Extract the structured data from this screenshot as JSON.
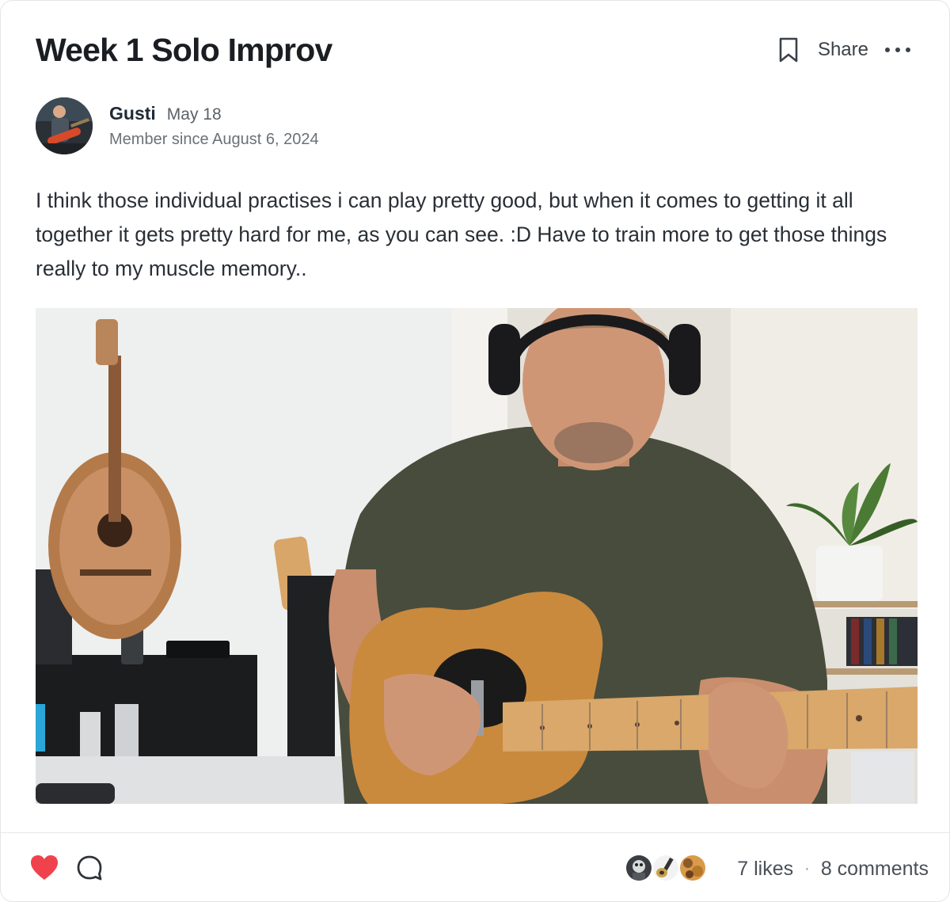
{
  "post": {
    "title": "Week 1 Solo Improv",
    "body": "I think those individual practises i can play pretty good, but when it comes to getting it all together it gets pretty hard for me, as you can see. :D Have to train more to get those things really to my muscle memory.."
  },
  "header": {
    "bookmark_icon": "bookmark-icon",
    "share_label": "Share",
    "more_icon": "more-icon"
  },
  "author": {
    "name": "Gusti",
    "date": "May 18",
    "member_since": "Member since August 6, 2024"
  },
  "footer": {
    "likes_label": "7 likes",
    "separator": "·",
    "comments_label": "8 comments",
    "like_color": "#f0424d"
  },
  "colors": {
    "text": "#1f2328",
    "muted": "#6b7178",
    "accent_like": "#f0424d"
  }
}
